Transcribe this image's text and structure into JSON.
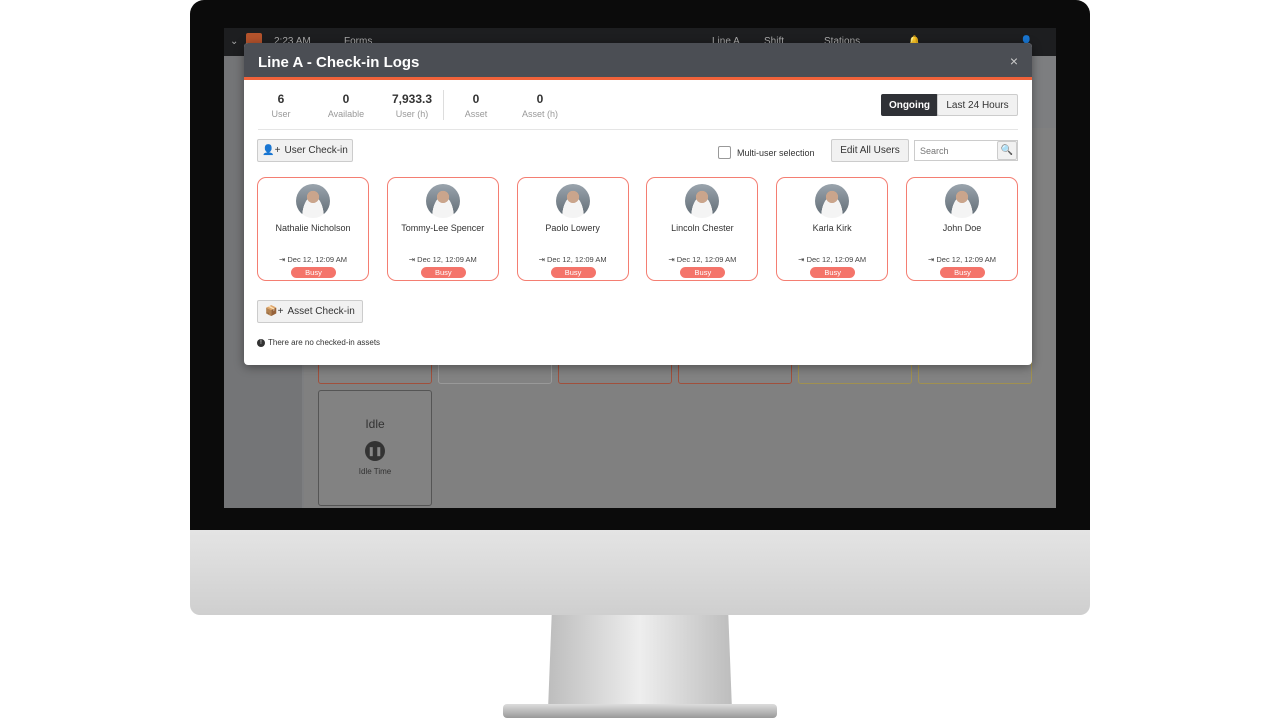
{
  "topbar": {
    "time": "2:23 AM",
    "forms": "Forms",
    "line": "Line A",
    "shift": "Shift",
    "stations": "Stations"
  },
  "background": {
    "idle_title": "Idle",
    "idle_label": "Idle Time"
  },
  "modal": {
    "title": "Line A - Check-in Logs",
    "close": "×",
    "stats": [
      {
        "value": "6",
        "label": "User"
      },
      {
        "value": "0",
        "label": "Available"
      },
      {
        "value": "7,933.3",
        "label": "User (h)"
      },
      {
        "value": "0",
        "label": "Asset"
      },
      {
        "value": "0",
        "label": "Asset (h)"
      }
    ],
    "tabs": [
      {
        "label": "Ongoing",
        "active": true
      },
      {
        "label": "Last 24 Hours",
        "active": false
      }
    ],
    "user_checkin": "User Check-in",
    "multi_user": "Multi-user selection",
    "edit_all": "Edit All Users",
    "search_placeholder": "Search",
    "users": [
      {
        "name": "Nathalie Nicholson",
        "time": "Dec 12, 12:09 AM",
        "status": "Busy"
      },
      {
        "name": "Tommy-Lee Spencer",
        "time": "Dec 12, 12:09 AM",
        "status": "Busy"
      },
      {
        "name": "Paolo Lowery",
        "time": "Dec 12, 12:09 AM",
        "status": "Busy"
      },
      {
        "name": "Lincoln Chester",
        "time": "Dec 12, 12:09 AM",
        "status": "Busy"
      },
      {
        "name": "Karla Kirk",
        "time": "Dec 12, 12:09 AM",
        "status": "Busy"
      },
      {
        "name": "John Doe",
        "time": "Dec 12, 12:09 AM",
        "status": "Busy"
      }
    ],
    "asset_checkin": "Asset Check-in",
    "no_assets": "There are no checked-in assets"
  },
  "colors": {
    "accent": "#f0623a",
    "busy": "#f4746a",
    "header": "#4b4e54"
  }
}
